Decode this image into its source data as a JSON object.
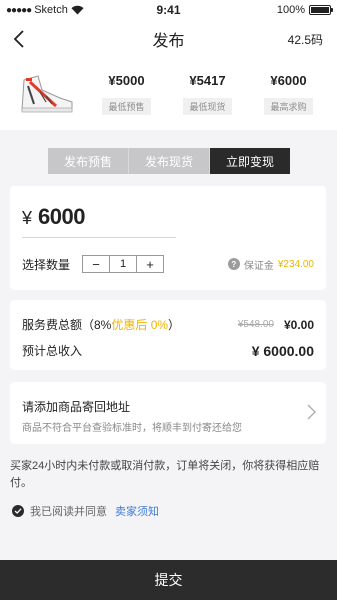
{
  "status_bar": {
    "carrier": "Sketch",
    "time": "9:41",
    "battery": "100%"
  },
  "nav": {
    "title": "发布",
    "size": "42.5码"
  },
  "product": {
    "prices": [
      {
        "value": "¥5000",
        "label": "最低预售"
      },
      {
        "value": "¥5417",
        "label": "最低现货"
      },
      {
        "value": "¥6000",
        "label": "最高求购"
      }
    ]
  },
  "tabs": [
    {
      "label": "发布预售",
      "active": false
    },
    {
      "label": "发布现货",
      "active": false
    },
    {
      "label": "立即变现",
      "active": true
    }
  ],
  "price_input": {
    "currency": "¥",
    "amount": "6000"
  },
  "quantity": {
    "label": "选择数量",
    "minus": "−",
    "value": "1",
    "plus": "+"
  },
  "deposit": {
    "icon": "?",
    "label": "保证金",
    "amount": "¥234.00"
  },
  "fees": {
    "service_label": "服务费总额（8%",
    "discount": "优惠后 0%",
    "close_paren": "）",
    "original_fee": "¥548.00",
    "fee": "¥0.00",
    "income_label": "预计总收入",
    "income": "¥ 6000.00"
  },
  "address": {
    "title": "请添加商品寄回地址",
    "subtitle": "商品不符合平台查验标准时，将顺丰到付寄还给您"
  },
  "notice": "买家24小时内未付款或取消付款，订单将关闭，你将获得相应赔付。",
  "agreement": {
    "text": "我已阅读并同意",
    "link": "卖家须知"
  },
  "submit_label": "提交",
  "colors": {
    "accent": "#f0b400",
    "dark": "#2a2a2a",
    "link": "#3d7bd9"
  }
}
